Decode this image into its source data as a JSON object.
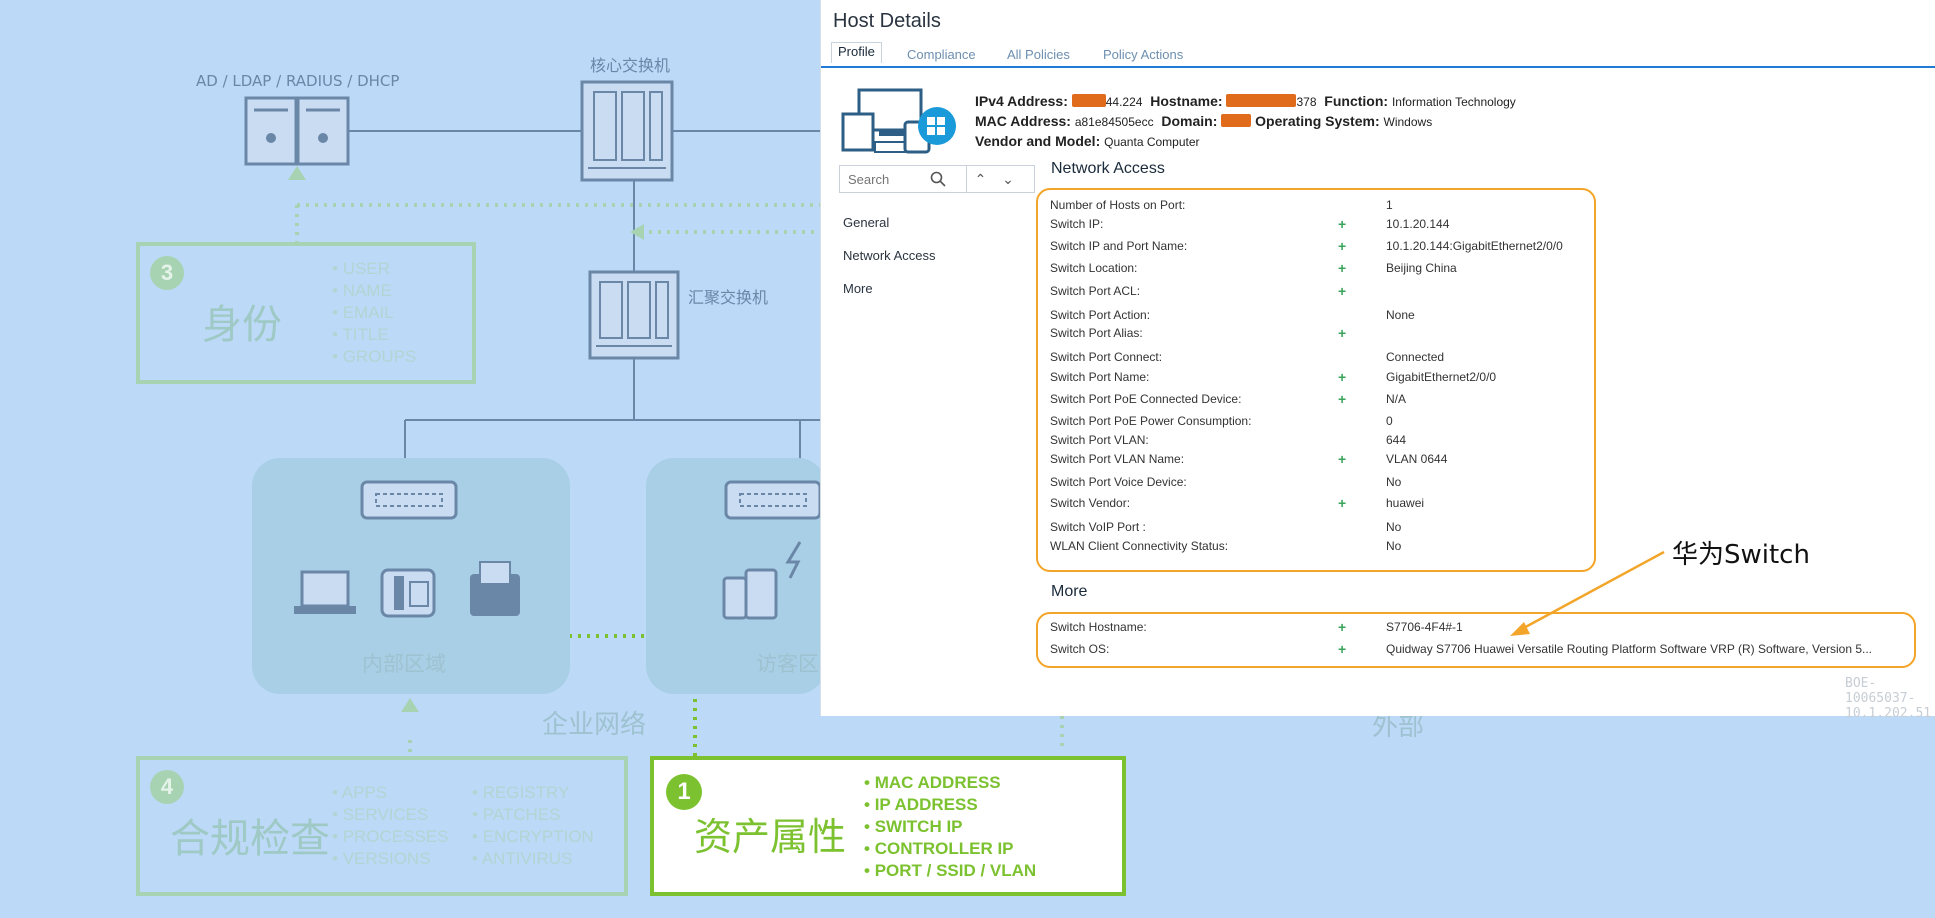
{
  "diagram": {
    "ad_label": "AD / LDAP / RADIUS / DHCP",
    "core_switch_label": "核心交换机",
    "agg_switch_label": "汇聚交换机",
    "internal_zone": "内部区域",
    "guest_zone": "访客区",
    "enterprise_network": "企业网络",
    "external": "外部",
    "identity": {
      "number": "3",
      "title": "身份",
      "items": [
        "USER",
        "NAME",
        "EMAIL",
        "TITLE",
        "GROUPS"
      ]
    },
    "compliance": {
      "number": "4",
      "title": "合规检查",
      "col1": [
        "APPS",
        "SERVICES",
        "PROCESSES",
        "VERSIONS"
      ],
      "col2": [
        "REGISTRY",
        "PATCHES",
        "ENCRYPTION",
        "ANTIVIRUS"
      ]
    },
    "asset": {
      "number": "1",
      "title": "资产属性",
      "items": [
        "MAC ADDRESS",
        "IP ADDRESS",
        "SWITCH IP",
        "CONTROLLER IP",
        "PORT / SSID / VLAN"
      ]
    }
  },
  "panel": {
    "title": "Host Details",
    "tabs": [
      "Profile",
      "Compliance",
      "All Policies",
      "Policy Actions"
    ],
    "host": {
      "ipv4_label": "IPv4 Address:",
      "ipv4_value": "44.224",
      "hostname_label": "Hostname:",
      "hostname_value": "378",
      "function_label": "Function:",
      "function_value": "Information Technology",
      "mac_label": "MAC Address:",
      "mac_value": "a81e84505ecc",
      "domain_label": "Domain:",
      "os_label": "Operating System:",
      "os_value": "Windows",
      "vendor_label": "Vendor and Model:",
      "vendor_value": "Quanta Computer"
    },
    "search_placeholder": "Search",
    "nav": [
      "General",
      "Network Access",
      "More"
    ],
    "network_access_title": "Network Access",
    "network_access_rows": [
      {
        "key": "Number of Hosts on Port:",
        "plus": "",
        "value": "1"
      },
      {
        "key": "Switch IP:",
        "plus": "+",
        "value": "10.1.20.144"
      },
      {
        "key": "Switch IP and Port Name:",
        "plus": "+",
        "value": "10.1.20.144:GigabitEthernet2/0/0"
      },
      {
        "key": "Switch Location:",
        "plus": "+",
        "value": "Beijing China"
      },
      {
        "key": "Switch Port ACL:",
        "plus": "+",
        "value": ""
      },
      {
        "key": "Switch Port Action:",
        "plus": "",
        "value": "None"
      },
      {
        "key": "Switch Port Alias:",
        "plus": "+",
        "value": ""
      },
      {
        "key": "Switch Port Connect:",
        "plus": "",
        "value": "Connected"
      },
      {
        "key": "Switch Port Name:",
        "plus": "+",
        "value": "GigabitEthernet2/0/0"
      },
      {
        "key": "Switch Port PoE Connected Device:",
        "plus": "+",
        "value": "N/A"
      },
      {
        "key": "Switch Port PoE Power Consumption:",
        "plus": "",
        "value": "0"
      },
      {
        "key": "Switch Port VLAN:",
        "plus": "",
        "value": "644"
      },
      {
        "key": "Switch Port VLAN Name:",
        "plus": "+",
        "value": "VLAN 0644"
      },
      {
        "key": "Switch Port Voice Device:",
        "plus": "",
        "value": "No"
      },
      {
        "key": "Switch Vendor:",
        "plus": "+",
        "value": "huawei"
      },
      {
        "key": "Switch VoIP Port :",
        "plus": "",
        "value": "No"
      },
      {
        "key": "WLAN Client Connectivity Status:",
        "plus": "",
        "value": "No"
      }
    ],
    "more_title": "More",
    "more_rows": [
      {
        "key": "Switch Hostname:",
        "plus": "+",
        "value": "S7706-4F4#-1"
      },
      {
        "key": "Switch OS:",
        "plus": "+",
        "value": "Quidway S7706 Huawei Versatile Routing Platform Software VRP (R) Software, Version 5..."
      }
    ],
    "watermark": "BOE-10065037-10.1.202.51"
  },
  "callout": "华为Switch",
  "colors": {
    "background": "#bcd9f7",
    "highlight_orange": "#f2a528",
    "asset_green": "#7cc230",
    "tab_accent": "#1f7bd4"
  }
}
